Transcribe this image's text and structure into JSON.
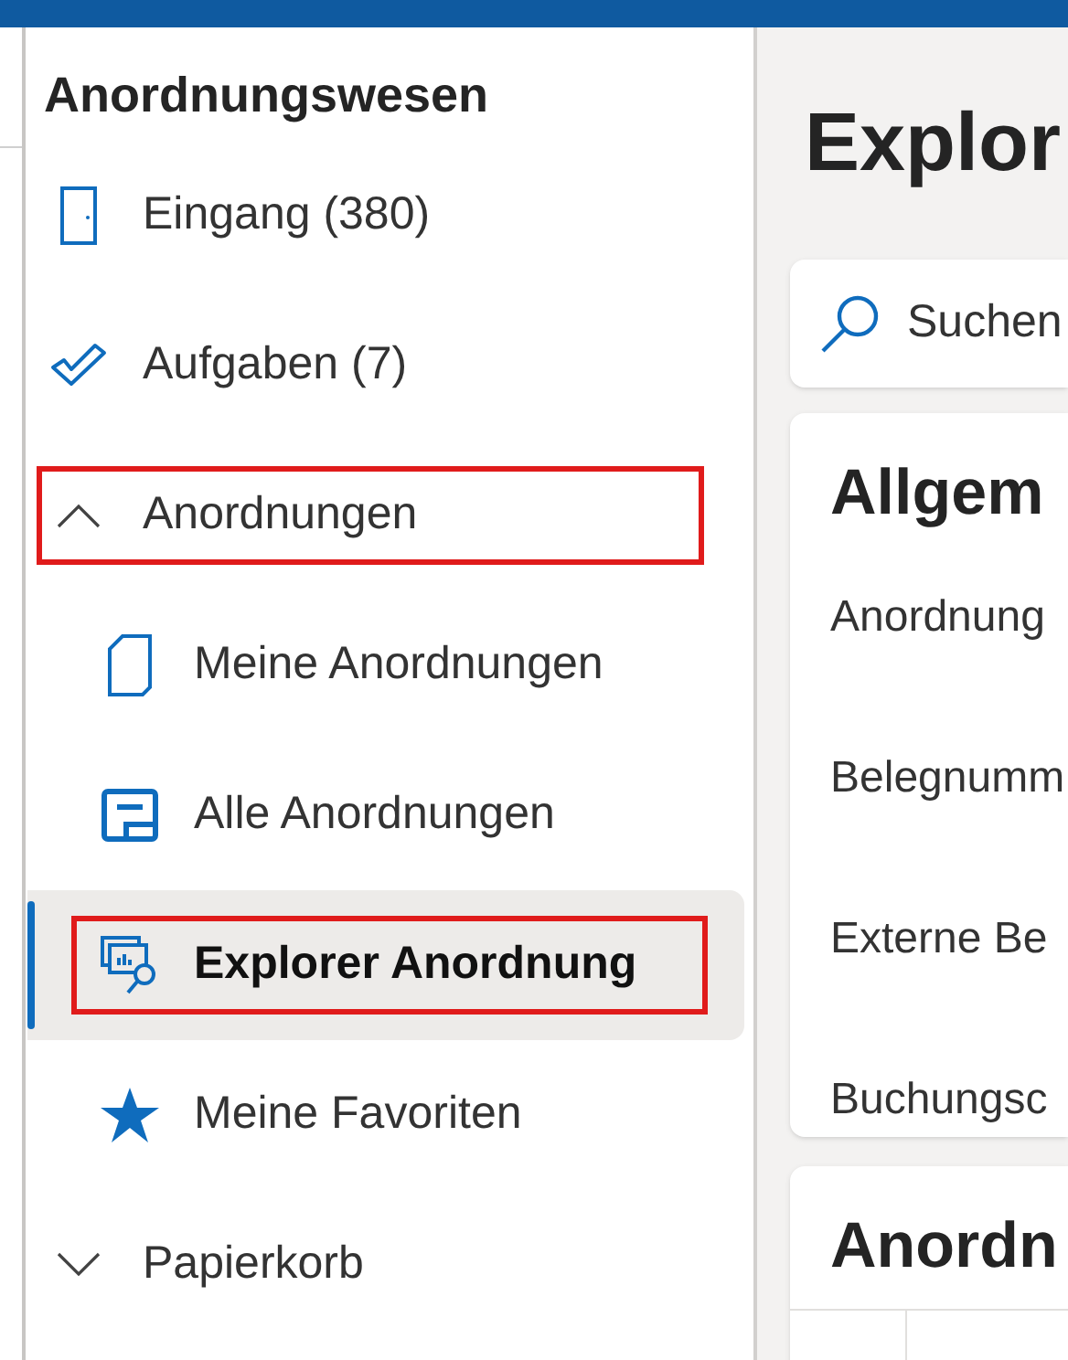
{
  "sidebar": {
    "title": "Anordnungswesen",
    "items": [
      {
        "kind": "inbox",
        "label": "Eingang (380)",
        "selected": false,
        "highlighted": false
      },
      {
        "kind": "tasks",
        "label": "Aufgaben (7)",
        "selected": false,
        "highlighted": false
      },
      {
        "kind": "group",
        "label": "Anordnungen",
        "expanded": true,
        "highlighted": true,
        "children": [
          {
            "kind": "page",
            "label": "Meine Anordnungen",
            "selected": false,
            "highlighted": false
          },
          {
            "kind": "form",
            "label": "Alle Anordnungen",
            "selected": false,
            "highlighted": false
          },
          {
            "kind": "explorer",
            "label": "Explorer Anordnung",
            "selected": true,
            "highlighted": true
          },
          {
            "kind": "star",
            "label": "Meine Favoriten",
            "selected": false,
            "highlighted": false
          }
        ]
      },
      {
        "kind": "group",
        "label": "Papierkorb",
        "expanded": false,
        "highlighted": false
      }
    ]
  },
  "main": {
    "title": "Explor",
    "search": {
      "placeholder": "Suchen"
    },
    "general": {
      "heading": "Allgem",
      "fields": [
        "Anordnung",
        "Belegnumm",
        "Externe Be",
        "Buchungsc"
      ]
    },
    "list": {
      "heading": "Anordn"
    }
  }
}
